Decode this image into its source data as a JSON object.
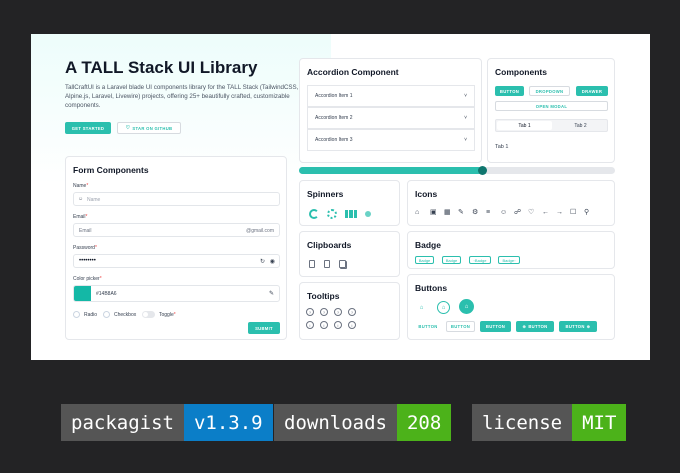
{
  "hero": {
    "title": "A TALL Stack UI Library",
    "description": "TallCraftUI is a Laravel blade UI components library for the TALL Stack (TailwindCSS, Alpine.js, Laravel, Livewire) projects, offering 25+ beautifully crafted, customizable components.",
    "get_started": "GET STARTED",
    "star": "STAR ON GITHUB"
  },
  "form": {
    "title": "Form Components",
    "name_label": "Name",
    "name_placeholder": "Name",
    "email_label": "Email",
    "email_value": "Email",
    "email_suffix": "@gmail.com",
    "password_label": "Password",
    "password_value": "••••••••",
    "color_label": "Color picker",
    "color_value": "#14B8A6",
    "radio_label": "Radio",
    "checkbox_label": "Checkbox",
    "toggle_label": "Toggle",
    "submit": "SUBMIT",
    "required_mark": "*"
  },
  "accordion": {
    "title": "Accordion Component",
    "items": [
      "Accordion Item 1",
      "Accordion Item 2",
      "Accordion Item 3"
    ]
  },
  "components": {
    "title": "Components",
    "button": "BUTTON",
    "dropdown": "DROPDOWN",
    "drawer": "DRAWER",
    "open_modal": "OPEN MODAL",
    "tab1": "Tab 1",
    "tab2": "Tab 2",
    "tab_content": "Tab 1"
  },
  "progress": {
    "value": 0.58
  },
  "spinners": {
    "title": "Spinners"
  },
  "clipboards": {
    "title": "Clipboards"
  },
  "tooltips": {
    "title": "Tooltips"
  },
  "icons": {
    "title": "Icons"
  },
  "badge": {
    "title": "Badge",
    "items": [
      "Badge",
      "Badge",
      "Badge",
      "Badge"
    ]
  },
  "buttons": {
    "title": "Buttons",
    "labels": [
      "BUTTON",
      "BUTTON",
      "BUTTON",
      "BUTTON",
      "BUTTON"
    ]
  },
  "shields": [
    {
      "label": "packagist",
      "value": "v1.3.9",
      "color": "#0b7ec8"
    },
    {
      "label": "downloads",
      "value": "208",
      "color": "#4cb21a"
    },
    {
      "label": "license",
      "value": "MIT",
      "color": "#4cb21a"
    }
  ],
  "colors": {
    "accent": "#2bbfae",
    "pill_label_bg": "#555555"
  }
}
